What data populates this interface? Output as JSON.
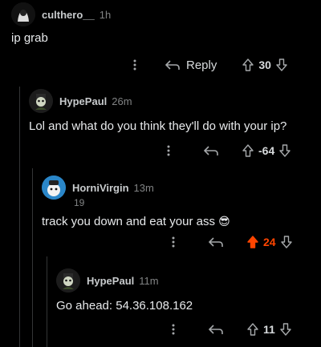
{
  "comments": [
    {
      "username": "culthero__",
      "time": "1h",
      "text": "ip grab",
      "score": "30",
      "reply_label": "Reply",
      "upvoted": false
    },
    {
      "username": "HypePaul",
      "time": "26m",
      "text": "Lol and what do you think they'll do with your ip?",
      "score": "-64",
      "upvoted": false
    },
    {
      "username": "HorniVirgin",
      "time": "13m",
      "flair": "19",
      "text": "track you down and eat your ass",
      "emoji": "😎",
      "score": "24",
      "upvoted": true
    },
    {
      "username": "HypePaul",
      "time": "11m",
      "text": "Go ahead: 54.36.108.162",
      "score": "11",
      "upvoted": false
    }
  ],
  "icons": {
    "more": "more-options-icon",
    "reply": "reply-arrow-icon",
    "upvote": "upvote-arrow-icon",
    "downvote": "downvote-arrow-icon"
  },
  "colors": {
    "upvote_active": "#ff4500",
    "background": "#000000"
  }
}
